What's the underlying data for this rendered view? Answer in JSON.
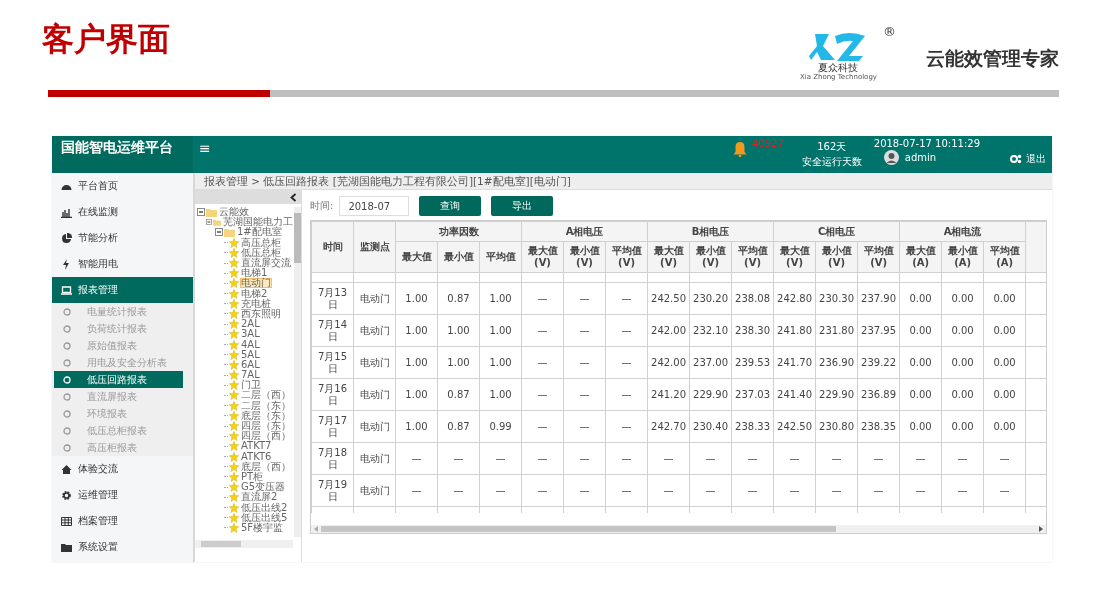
{
  "slide": {
    "title": "客户界面",
    "logo_text": "夏众科技",
    "logo_subtext": "Xia Zhong Technology",
    "registered_mark": "®",
    "slogan": "云能效管理专家"
  },
  "app": {
    "title": "国能智电运维平台",
    "menu_glyph": "≡",
    "alarm_count": "40927",
    "safe_days": "162天",
    "safe_days_label": "安全运行天数",
    "datetime": "2018-07-17 10:11:29",
    "user": "admin",
    "logout": "退出"
  },
  "sidebar": [
    {
      "label": "平台首页",
      "selected": false
    },
    {
      "label": "在线监测",
      "selected": false
    },
    {
      "label": "节能分析",
      "selected": false
    },
    {
      "label": "智能用电",
      "selected": false
    },
    {
      "label": "报表管理",
      "selected": true,
      "expanded": true,
      "children": [
        {
          "label": "电量统计报表",
          "selected": false
        },
        {
          "label": "负荷统计报表",
          "selected": false
        },
        {
          "label": "原始值报表",
          "selected": false
        },
        {
          "label": "用电及安全分析表",
          "selected": false
        },
        {
          "label": "低压回路报表",
          "selected": true
        },
        {
          "label": "直流屏报表",
          "selected": false
        },
        {
          "label": "环境报表",
          "selected": false
        },
        {
          "label": "低压总柜报表",
          "selected": false
        },
        {
          "label": "高压柜报表",
          "selected": false
        }
      ]
    },
    {
      "label": "体验交流",
      "selected": false
    },
    {
      "label": "运维管理",
      "selected": false
    },
    {
      "label": "档案管理",
      "selected": false
    },
    {
      "label": "系统设置",
      "selected": false
    }
  ],
  "breadcrumb": "报表管理 > 低压回路报表 [芜湖国能电力工程有限公司][1#配电室][电动门]",
  "tree": [
    {
      "label": "云能效",
      "kind": "folder",
      "expanded": true,
      "children": [
        {
          "label": "芜湖国能电力工",
          "kind": "folder",
          "expanded": true,
          "children": [
            {
              "label": "1#配电室",
              "kind": "folder",
              "expanded": true,
              "children": [
                {
                  "label": "高压总柜",
                  "kind": "leaf",
                  "selected": false
                },
                {
                  "label": "低压总柜",
                  "kind": "leaf",
                  "selected": false
                },
                {
                  "label": "直流屏交流",
                  "kind": "leaf",
                  "selected": false
                },
                {
                  "label": "电梯1",
                  "kind": "leaf",
                  "selected": false
                },
                {
                  "label": "电动门",
                  "kind": "leaf",
                  "selected": true
                },
                {
                  "label": "电梯2",
                  "kind": "leaf",
                  "selected": false
                },
                {
                  "label": "充电桩",
                  "kind": "leaf",
                  "selected": false
                },
                {
                  "label": "西东照明",
                  "kind": "leaf",
                  "selected": false
                },
                {
                  "label": "2AL",
                  "kind": "leaf",
                  "selected": false
                },
                {
                  "label": "3AL",
                  "kind": "leaf",
                  "selected": false
                },
                {
                  "label": "4AL",
                  "kind": "leaf",
                  "selected": false
                },
                {
                  "label": "5AL",
                  "kind": "leaf",
                  "selected": false
                },
                {
                  "label": "6AL",
                  "kind": "leaf",
                  "selected": false
                },
                {
                  "label": "7AL",
                  "kind": "leaf",
                  "selected": false
                },
                {
                  "label": "门卫",
                  "kind": "leaf",
                  "selected": false
                },
                {
                  "label": "二层（西）",
                  "kind": "leaf",
                  "selected": false
                },
                {
                  "label": "二层（东）",
                  "kind": "leaf",
                  "selected": false
                },
                {
                  "label": "底层（东）",
                  "kind": "leaf",
                  "selected": false
                },
                {
                  "label": "四层（东）",
                  "kind": "leaf",
                  "selected": false
                },
                {
                  "label": "四层（西）",
                  "kind": "leaf",
                  "selected": false
                },
                {
                  "label": "ATKT7",
                  "kind": "leaf",
                  "selected": false
                },
                {
                  "label": "ATKT6",
                  "kind": "leaf",
                  "selected": false
                },
                {
                  "label": "底层（西）",
                  "kind": "leaf",
                  "selected": false
                },
                {
                  "label": "PT柜",
                  "kind": "leaf",
                  "selected": false
                },
                {
                  "label": "G5变压器",
                  "kind": "leaf",
                  "selected": false
                },
                {
                  "label": "直流屏2",
                  "kind": "leaf",
                  "selected": false
                },
                {
                  "label": "低压出线2",
                  "kind": "leaf",
                  "selected": false
                },
                {
                  "label": "低压出线5",
                  "kind": "leaf",
                  "selected": false
                },
                {
                  "label": "5F楼宇监",
                  "kind": "leaf",
                  "selected": false
                }
              ]
            }
          ]
        }
      ]
    }
  ],
  "filter": {
    "label": "时间:",
    "value": "2018-07"
  },
  "buttons": [
    "查询",
    "导出"
  ],
  "table": {
    "fixed_columns": [
      "时间",
      "监测点"
    ],
    "groups": [
      {
        "label": "功率因数",
        "columns": [
          "最大值",
          "最小值",
          "平均值"
        ]
      },
      {
        "label": "A相电压",
        "columns": [
          "最大值 (V)",
          "最小值 (V)",
          "平均值 (V)"
        ]
      },
      {
        "label": "B相电压",
        "columns": [
          "最大值 (V)",
          "最小值 (V)",
          "平均值 (V)"
        ]
      },
      {
        "label": "C相电压",
        "columns": [
          "最大值 (V)",
          "最小值 (V)",
          "平均值 (V)"
        ]
      },
      {
        "label": "A相电流",
        "columns": [
          "最大值 (A)",
          "最小值 (A)",
          "平均值 (A)"
        ]
      }
    ],
    "rows": [
      {
        "date": "7月13日",
        "point": "电动门",
        "values": [
          "1.00",
          "0.87",
          "1.00",
          "—",
          "—",
          "—",
          "242.50",
          "230.20",
          "238.08",
          "242.80",
          "230.30",
          "237.90",
          "0.00",
          "0.00",
          "0.00"
        ]
      },
      {
        "date": "7月14日",
        "point": "电动门",
        "values": [
          "1.00",
          "1.00",
          "1.00",
          "—",
          "—",
          "—",
          "242.00",
          "232.10",
          "238.30",
          "241.80",
          "231.80",
          "237.95",
          "0.00",
          "0.00",
          "0.00"
        ]
      },
      {
        "date": "7月15日",
        "point": "电动门",
        "values": [
          "1.00",
          "1.00",
          "1.00",
          "—",
          "—",
          "—",
          "242.00",
          "237.00",
          "239.53",
          "241.70",
          "236.90",
          "239.22",
          "0.00",
          "0.00",
          "0.00"
        ]
      },
      {
        "date": "7月16日",
        "point": "电动门",
        "values": [
          "1.00",
          "0.87",
          "1.00",
          "—",
          "—",
          "—",
          "241.20",
          "229.90",
          "237.03",
          "241.40",
          "229.90",
          "236.89",
          "0.00",
          "0.00",
          "0.00"
        ]
      },
      {
        "date": "7月17日",
        "point": "电动门",
        "values": [
          "1.00",
          "0.87",
          "0.99",
          "—",
          "—",
          "—",
          "242.70",
          "230.40",
          "238.33",
          "242.50",
          "230.80",
          "238.35",
          "0.00",
          "0.00",
          "0.00"
        ]
      },
      {
        "date": "7月18日",
        "point": "电动门",
        "values": [
          "—",
          "—",
          "—",
          "—",
          "—",
          "—",
          "—",
          "—",
          "—",
          "—",
          "—",
          "—",
          "—",
          "—",
          "—"
        ]
      },
      {
        "date": "7月19日",
        "point": "电动门",
        "values": [
          "—",
          "—",
          "—",
          "—",
          "—",
          "—",
          "—",
          "—",
          "—",
          "—",
          "—",
          "—",
          "—",
          "—",
          "—"
        ]
      }
    ]
  }
}
